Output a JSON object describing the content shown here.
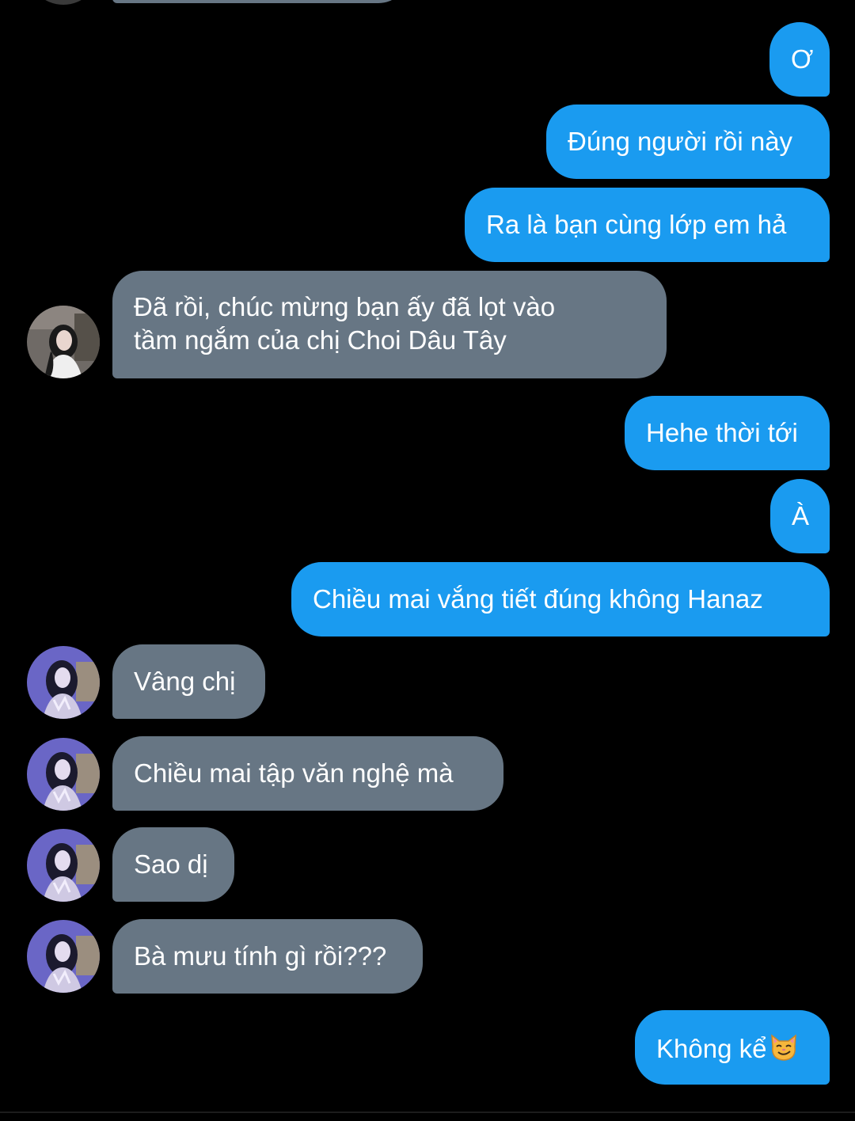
{
  "messages": [
    {
      "side": "in",
      "text": ""
    },
    {
      "side": "out",
      "text": "Ơ"
    },
    {
      "side": "out",
      "text": "Đúng người rồi này"
    },
    {
      "side": "out",
      "text": "Ra là bạn cùng lớp em hả"
    },
    {
      "side": "in",
      "line1": "Đã rồi, chúc mừng bạn ấy đã lọt vào",
      "line2": "tầm ngắm của chị Choi Dâu Tây"
    },
    {
      "side": "out",
      "text": "Hehe thời tới"
    },
    {
      "side": "out",
      "text": "À"
    },
    {
      "side": "out",
      "text": "Chiều mai vắng tiết đúng không Hanaz"
    },
    {
      "side": "in",
      "text": "Vâng chị"
    },
    {
      "side": "in",
      "text": "Chiều mai tập văn nghệ mà"
    },
    {
      "side": "in",
      "text": "Sao dị"
    },
    {
      "side": "in",
      "text": "Bà mưu tính gì rồi???"
    },
    {
      "side": "out",
      "text": "Không kể",
      "emoji": "smirking-cat-emoji"
    }
  ],
  "colors": {
    "background": "#000000",
    "outgoing_bubble": "#1a9bf0",
    "incoming_bubble": "#677684",
    "text": "#ffffff"
  },
  "icons": {
    "avatar_1": "avatar-dark-photo",
    "avatar_2": "avatar-purple-photo"
  }
}
